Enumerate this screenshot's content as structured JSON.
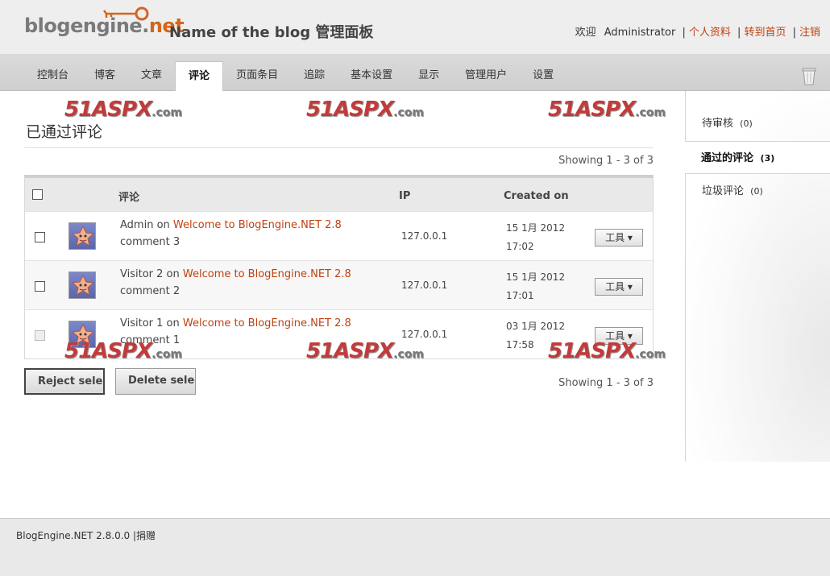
{
  "header": {
    "logo_main": "blogengine.",
    "logo_net": "net",
    "site_title": "Name of the blog 管理面板",
    "welcome": "欢迎",
    "username": "Administrator",
    "profile_link": "个人资料",
    "home_link": "转到首页",
    "logout_link": "注销",
    "separator": "|"
  },
  "nav": {
    "items": [
      "控制台",
      "博客",
      "文章",
      "评论",
      "页面条目",
      "追踪",
      "基本设置",
      "显示",
      "管理用户",
      "设置"
    ],
    "active": "评论"
  },
  "watermark": {
    "text": "51ASPX",
    "suffix": ".com"
  },
  "main": {
    "page_title": "已通过评论",
    "showing": "Showing 1 - 3 of 3",
    "columns": {
      "comment": "评论",
      "ip": "IP",
      "created": "Created on"
    },
    "rows": [
      {
        "author": "Admin",
        "on": "on",
        "post": "Welcome to BlogEngine.NET 2.8",
        "text": "comment 3",
        "ip": "127.0.0.1",
        "date": "15 1月 2012",
        "time": "17:02",
        "tools": "工具"
      },
      {
        "author": "Visitor 2",
        "on": "on",
        "post": "Welcome to BlogEngine.NET 2.8",
        "text": "comment 2",
        "ip": "127.0.0.1",
        "date": "15 1月 2012",
        "time": "17:01",
        "tools": "工具"
      },
      {
        "author": "Visitor 1",
        "on": "on",
        "post": "Welcome to BlogEngine.NET 2.8",
        "text": "comment 1",
        "ip": "127.0.0.1",
        "date": "03 1月 2012",
        "time": "17:58",
        "tools": "工具"
      }
    ],
    "reject_label": "Reject selected",
    "delete_label": "Delete selected"
  },
  "sidebar": {
    "items": [
      {
        "label": "待审核",
        "count": "(0)"
      },
      {
        "label": "通过的评论",
        "count": "(3)"
      },
      {
        "label": "垃圾评论",
        "count": "(0)"
      }
    ]
  },
  "footer": {
    "version": "BlogEngine.NET 2.8.0.0",
    "separator": "|",
    "donate": "捐赠"
  },
  "colors": {
    "accent": "#c0410f",
    "watermark": "#c23b3b"
  }
}
